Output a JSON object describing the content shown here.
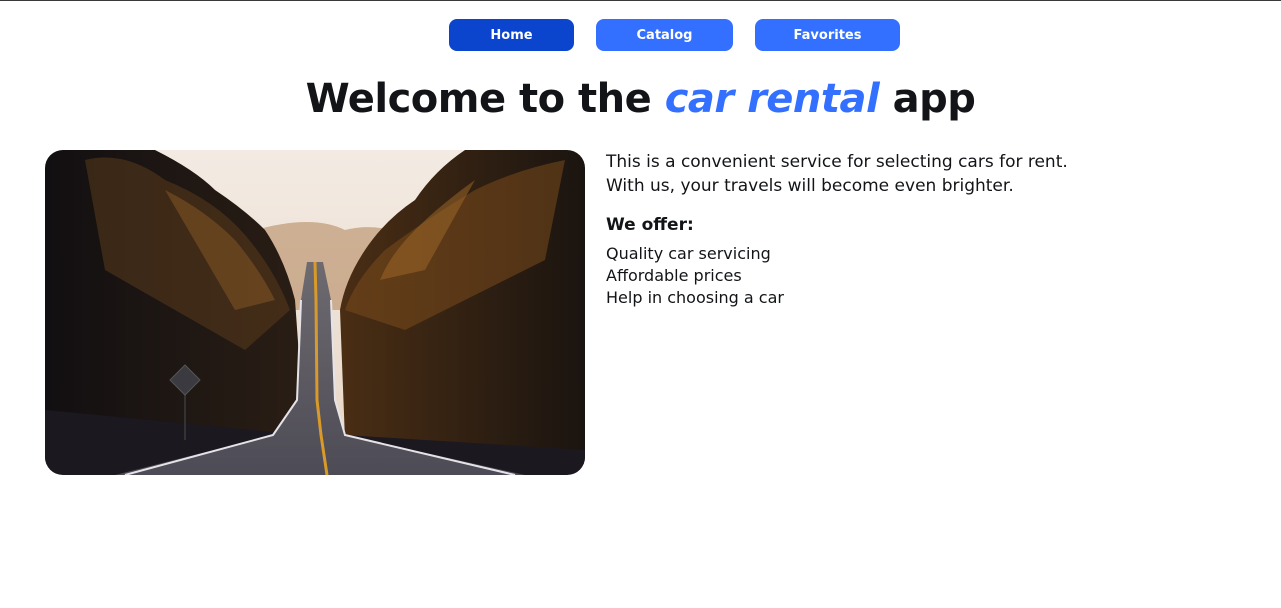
{
  "nav": {
    "items": [
      {
        "label": "Home",
        "active": true
      },
      {
        "label": "Catalog",
        "active": false
      },
      {
        "label": "Favorites",
        "active": false
      }
    ]
  },
  "hero": {
    "title_before": "Welcome to the",
    "title_accent": "car rental",
    "title_after": "app",
    "image_alt": "road-through-forest-photo"
  },
  "content": {
    "intro_line1": "This is a convenient service for selecting cars for rent.",
    "intro_line2": "With us, your travels will become even brighter.",
    "offer_title": "We offer:",
    "offers": [
      "Quality car servicing",
      "Affordable prices",
      "Help in choosing a car"
    ]
  },
  "colors": {
    "accent": "#3470ff",
    "active_nav": "#0b44cd",
    "text": "#121417"
  }
}
